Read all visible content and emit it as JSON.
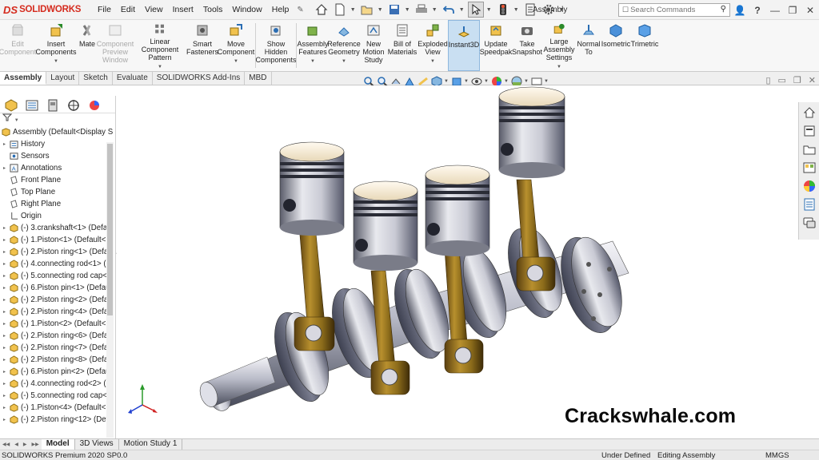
{
  "app": {
    "logo_prefix": "DS",
    "logo_text": "SOLIDWORKS",
    "document_title": "Assembly",
    "brand_color": "#d52b1e"
  },
  "menu": [
    "File",
    "Edit",
    "View",
    "Insert",
    "Tools",
    "Window",
    "Help"
  ],
  "search": {
    "placeholder": "Search Commands"
  },
  "title_icons": [
    "new-doc-icon",
    "open-icon",
    "save-icon",
    "print-icon",
    "undo-icon",
    "select-icon",
    "traffic-light-icon",
    "options-icon"
  ],
  "commands": [
    {
      "label": "Edit Component",
      "disabled": true,
      "icon": "edit-component-icon"
    },
    {
      "label": "Insert Components",
      "disabled": false,
      "icon": "insert-components-icon"
    },
    {
      "label": "Mate",
      "disabled": false,
      "icon": "mate-icon"
    },
    {
      "label": "Component Preview Window",
      "disabled": true,
      "icon": "preview-icon"
    },
    {
      "label": "Linear Component Pattern",
      "disabled": false,
      "icon": "pattern-icon"
    },
    {
      "label": "Smart Fasteners",
      "disabled": false,
      "icon": "fasteners-icon"
    },
    {
      "label": "Move Component",
      "disabled": false,
      "icon": "move-icon"
    },
    {
      "label": "Show Hidden Components",
      "disabled": false,
      "icon": "show-hidden-icon"
    },
    {
      "label": "Assembly Features",
      "disabled": false,
      "icon": "assembly-features-icon"
    },
    {
      "label": "Reference Geometry",
      "disabled": false,
      "icon": "reference-geometry-icon"
    },
    {
      "label": "New Motion Study",
      "disabled": false,
      "icon": "motion-study-icon"
    },
    {
      "label": "Bill of Materials",
      "disabled": false,
      "icon": "bom-icon"
    },
    {
      "label": "Exploded View",
      "disabled": false,
      "icon": "exploded-view-icon"
    },
    {
      "label": "Instant3D",
      "disabled": false,
      "icon": "instant3d-icon",
      "active": true
    },
    {
      "label": "Update Speedpak",
      "disabled": false,
      "icon": "speedpak-icon"
    },
    {
      "label": "Take Snapshot",
      "disabled": false,
      "icon": "snapshot-icon"
    },
    {
      "label": "Large Assembly Settings",
      "disabled": false,
      "icon": "large-assembly-icon"
    },
    {
      "label": "Normal To",
      "disabled": false,
      "icon": "normal-to-icon"
    },
    {
      "label": "Isometric",
      "disabled": false,
      "icon": "isometric-icon"
    },
    {
      "label": "Trimetric",
      "disabled": false,
      "icon": "trimetric-icon"
    }
  ],
  "tabs": [
    "Assembly",
    "Layout",
    "Sketch",
    "Evaluate",
    "SOLIDWORKS Add-Ins",
    "MBD"
  ],
  "active_tab": "Assembly",
  "tree": {
    "root": "Assembly  (Default<Display S",
    "items": [
      {
        "label": "History",
        "expand": true,
        "icon": "history-icon"
      },
      {
        "label": "Sensors",
        "expand": false,
        "icon": "sensors-icon"
      },
      {
        "label": "Annotations",
        "expand": true,
        "icon": "annotations-icon"
      },
      {
        "label": "Front Plane",
        "expand": false,
        "icon": "plane-icon"
      },
      {
        "label": "Top Plane",
        "expand": false,
        "icon": "plane-icon"
      },
      {
        "label": "Right Plane",
        "expand": false,
        "icon": "plane-icon"
      },
      {
        "label": "Origin",
        "expand": false,
        "icon": "origin-icon"
      },
      {
        "label": "(-) 3.crankshaft<1> (Defau",
        "expand": true,
        "icon": "part-icon"
      },
      {
        "label": "(-) 1.Piston<1> (Default<",
        "expand": true,
        "icon": "part-icon"
      },
      {
        "label": "(-) 2.Piston ring<1> (Defa",
        "expand": true,
        "icon": "part-icon"
      },
      {
        "label": "(-) 4.connecting rod<1> (",
        "expand": true,
        "icon": "part-icon"
      },
      {
        "label": "(-) 5.connecting rod cap<",
        "expand": true,
        "icon": "part-icon"
      },
      {
        "label": "(-) 6.Piston pin<1> (Defau",
        "expand": true,
        "icon": "part-icon"
      },
      {
        "label": "(-) 2.Piston ring<2> (Defa",
        "expand": true,
        "icon": "part-icon"
      },
      {
        "label": "(-) 2.Piston ring<4> (Defa",
        "expand": true,
        "icon": "part-icon"
      },
      {
        "label": "(-) 1.Piston<2> (Default<",
        "expand": true,
        "icon": "part-icon"
      },
      {
        "label": "(-) 2.Piston ring<6> (Defa",
        "expand": true,
        "icon": "part-icon"
      },
      {
        "label": "(-) 2.Piston ring<7> (Defa",
        "expand": true,
        "icon": "part-icon"
      },
      {
        "label": "(-) 2.Piston ring<8> (Defa",
        "expand": true,
        "icon": "part-icon"
      },
      {
        "label": "(-) 6.Piston pin<2> (Defau",
        "expand": true,
        "icon": "part-icon"
      },
      {
        "label": "(-) 4.connecting rod<2> (",
        "expand": true,
        "icon": "part-icon"
      },
      {
        "label": "(-) 5.connecting rod cap<",
        "expand": true,
        "icon": "part-icon"
      },
      {
        "label": "(-) 1.Piston<4> (Default<",
        "expand": true,
        "icon": "part-icon"
      },
      {
        "label": "(-) 2.Piston ring<12> (Def",
        "expand": true,
        "icon": "part-icon"
      }
    ]
  },
  "task_pane_icons": [
    "home-icon",
    "design-library-icon",
    "file-explorer-icon",
    "view-palette-icon",
    "appearances-icon",
    "custom-properties-icon",
    "forum-icon"
  ],
  "watermark": "Crackswhale.com",
  "bottom_tabs": [
    "Model",
    "3D Views",
    "Motion Study 1"
  ],
  "active_bottom_tab": "Model",
  "status": {
    "left": "SOLIDWORKS Premium 2020 SP0.0",
    "state": "Under Defined",
    "mode": "Editing Assembly",
    "units": "MMGS"
  }
}
